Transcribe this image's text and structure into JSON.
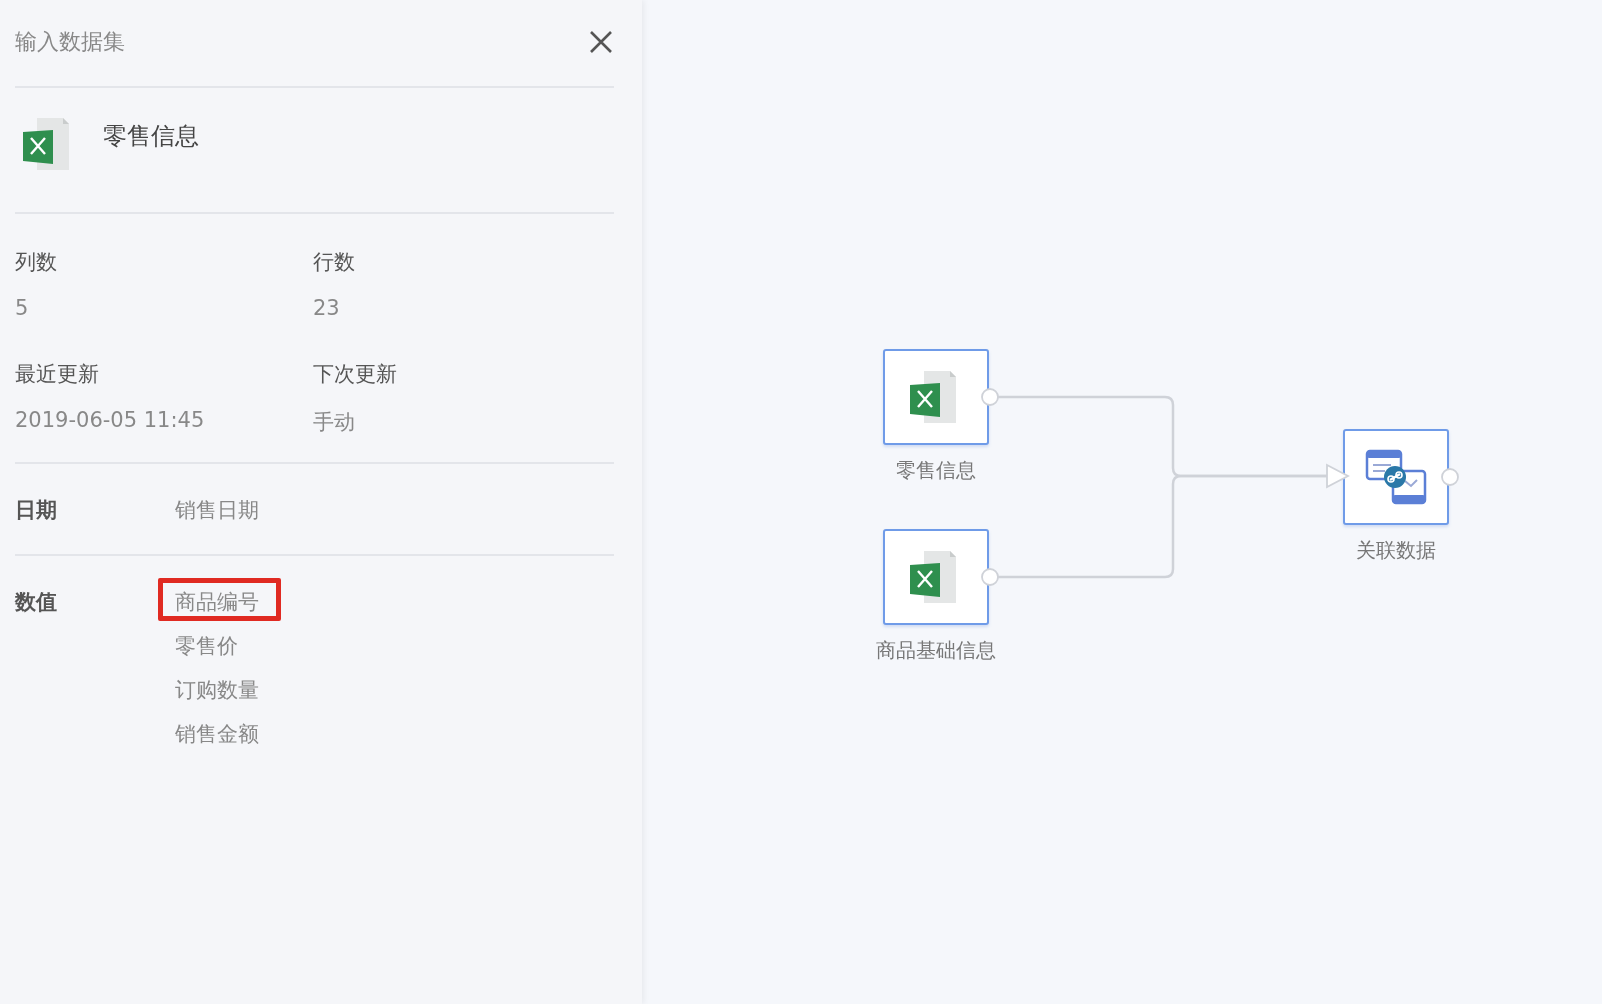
{
  "panel": {
    "title": "输入数据集",
    "dataset": {
      "kind": "excel",
      "name": "零售信息"
    },
    "stats": [
      {
        "label": "列数",
        "value": "5"
      },
      {
        "label": "行数",
        "value": "23"
      },
      {
        "label": "最近更新",
        "value": "2019-06-05 11:45"
      },
      {
        "label": "下次更新",
        "value": "手动"
      }
    ],
    "field_groups": [
      {
        "label": "日期",
        "fields": [
          {
            "name": "销售日期",
            "highlighted": false
          }
        ]
      },
      {
        "label": "数值",
        "fields": [
          {
            "name": "商品编号",
            "highlighted": true
          },
          {
            "name": "零售价",
            "highlighted": false
          },
          {
            "name": "订购数量",
            "highlighted": false
          },
          {
            "name": "销售金额",
            "highlighted": false
          }
        ]
      }
    ]
  },
  "flow": {
    "nodes": [
      {
        "kind": "excel",
        "label": "零售信息"
      },
      {
        "kind": "excel",
        "label": "商品基础信息"
      },
      {
        "kind": "join",
        "label": "关联数据"
      }
    ]
  }
}
